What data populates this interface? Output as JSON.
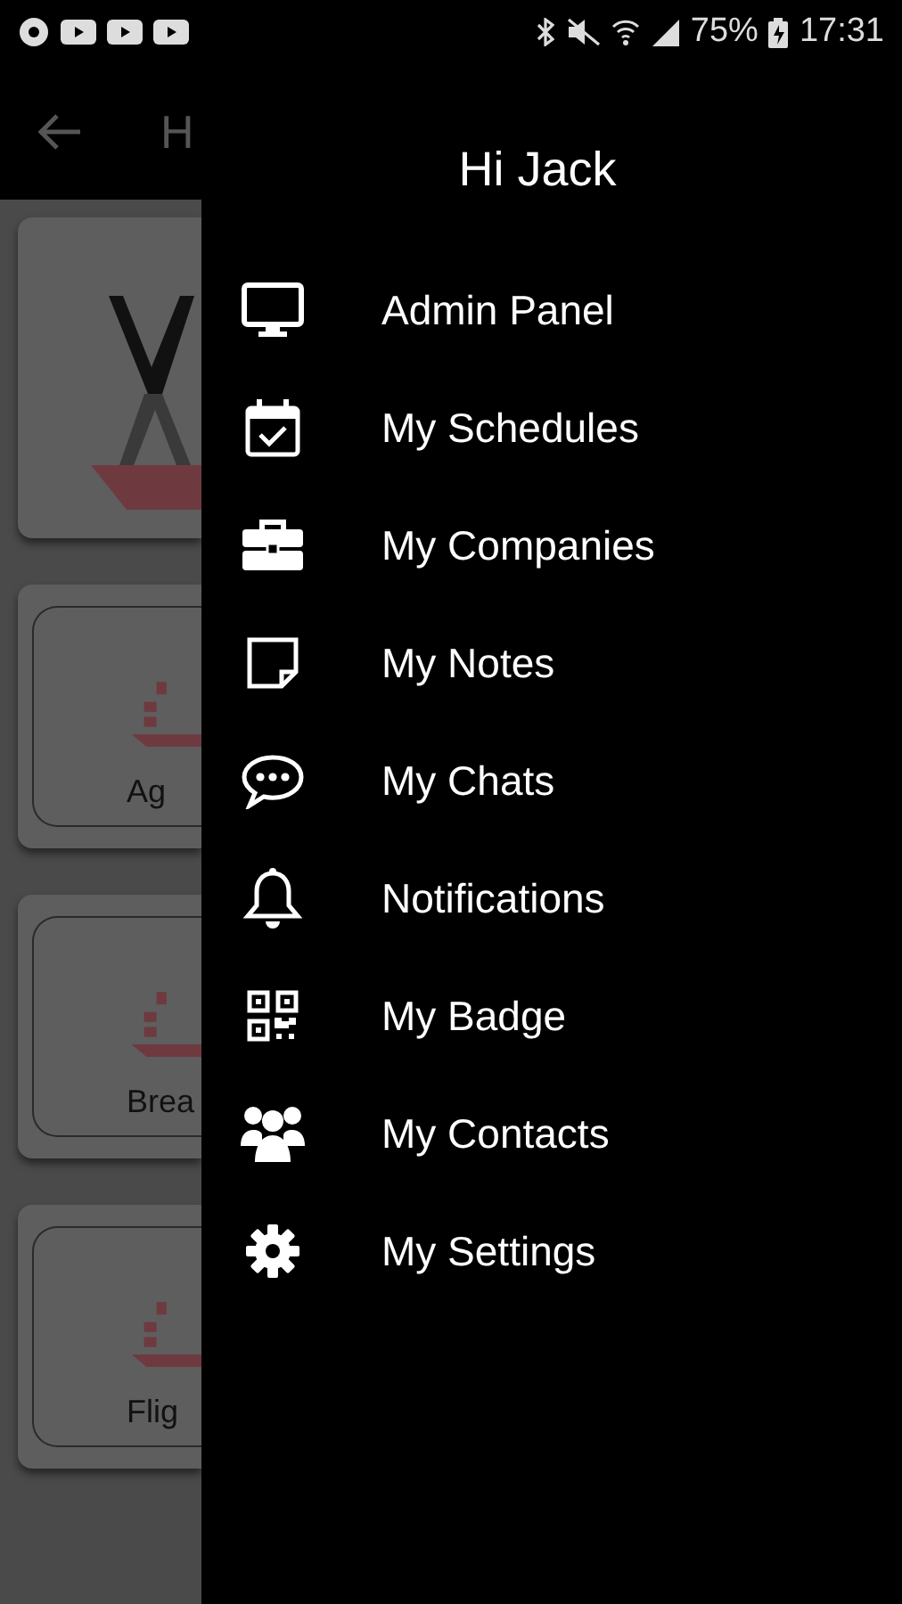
{
  "status_bar": {
    "battery": "75%",
    "time": "17:31"
  },
  "app_header": {
    "title": "H"
  },
  "cards": [
    {
      "kind": "logo"
    },
    {
      "kind": "tile",
      "label": "Ag"
    },
    {
      "kind": "tile",
      "label": "Brea"
    },
    {
      "kind": "tile",
      "label": "Flig"
    }
  ],
  "drawer": {
    "greeting": "Hi Jack",
    "items": [
      {
        "label": "Admin Panel"
      },
      {
        "label": "My Schedules"
      },
      {
        "label": "My Companies"
      },
      {
        "label": "My Notes"
      },
      {
        "label": "My Chats"
      },
      {
        "label": "Notifications"
      },
      {
        "label": "My Badge"
      },
      {
        "label": "My Contacts"
      },
      {
        "label": "My Settings"
      }
    ]
  }
}
